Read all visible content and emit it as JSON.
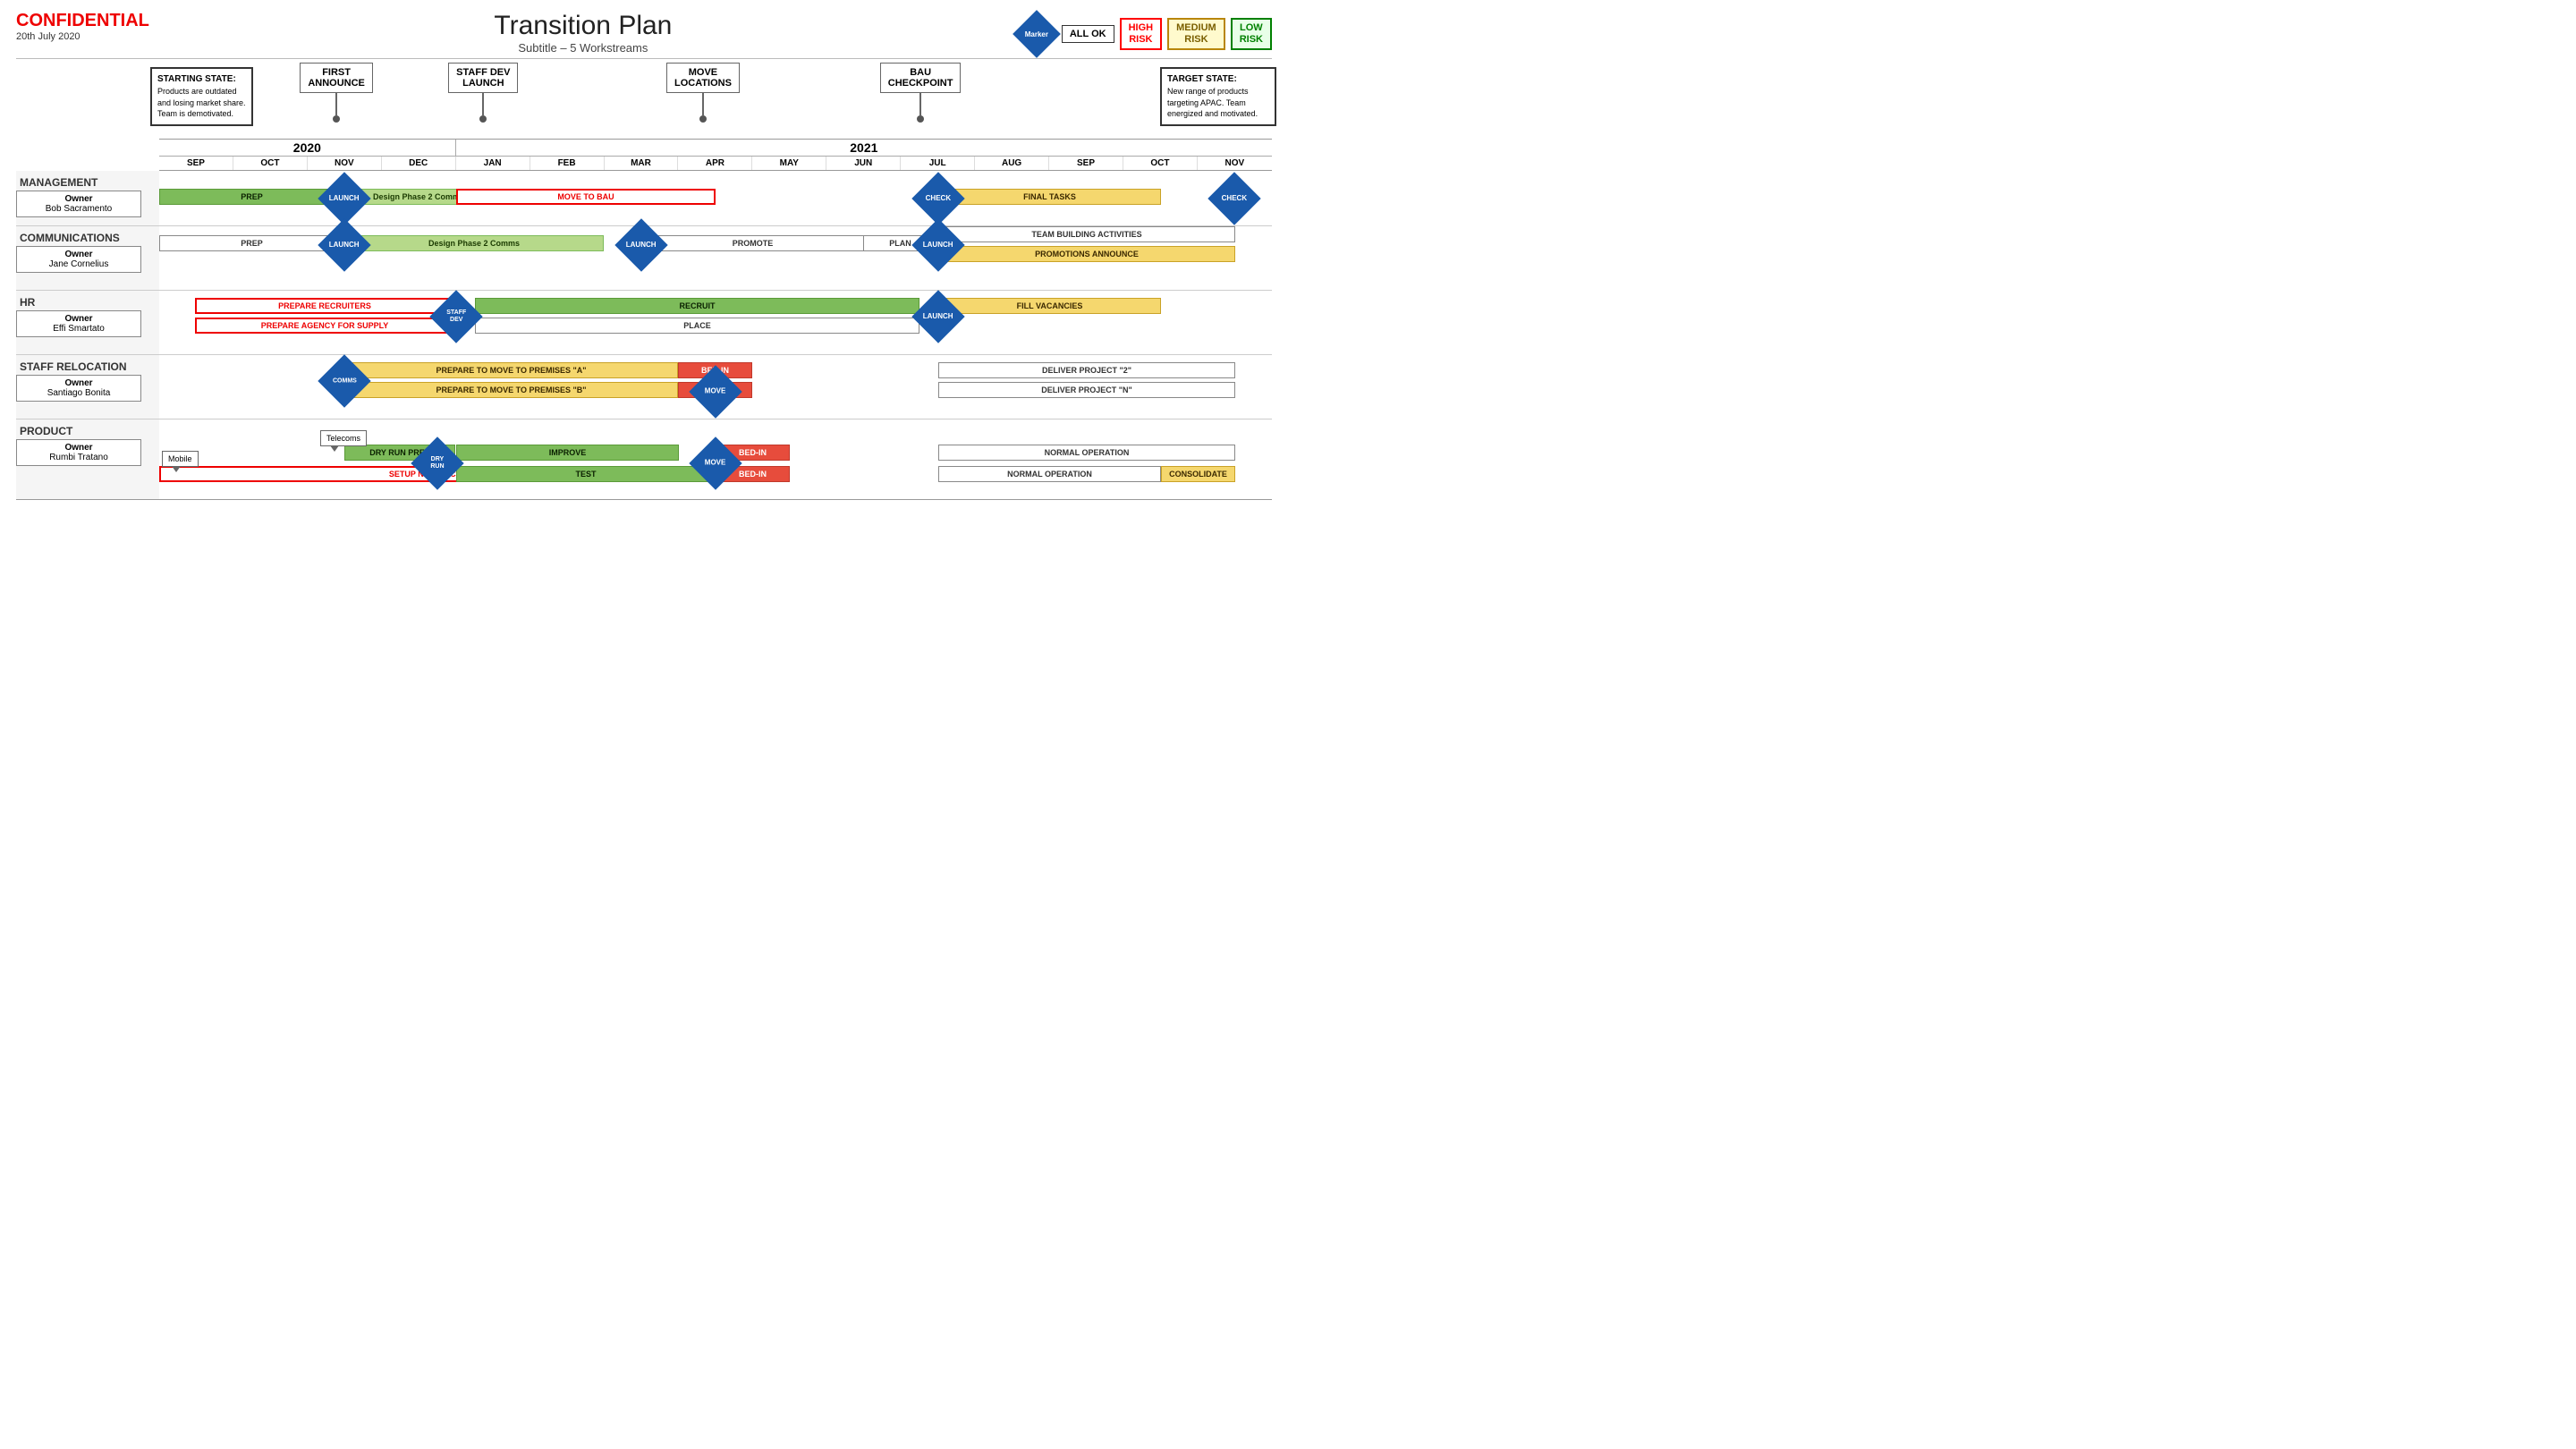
{
  "header": {
    "confidential": "CONFIDENTIAL",
    "date": "20th July 2020",
    "title": "Transition Plan",
    "subtitle": "Subtitle – 5 Workstreams",
    "legend_marker": "Marker",
    "legend_all_ok": "ALL OK",
    "legend_high": "HIGH\nRISK",
    "legend_medium": "MEDIUM\nRISK",
    "legend_low": "LOW\nRISK"
  },
  "milestones": [
    {
      "label": "FIRST ANNOUNCE",
      "col": 2
    },
    {
      "label": "STAFF DEV LAUNCH",
      "col": 4
    },
    {
      "label": "MOVE LOCATIONS",
      "col": 7
    },
    {
      "label": "BAU CHECKPOINT",
      "col": 10
    }
  ],
  "starting_state": "Products are outdated and losing market share. Team is demotivated.",
  "target_state": "New range of products targeting APAC. Team energized and motivated.",
  "months": [
    "SEP",
    "OCT",
    "NOV",
    "DEC",
    "JAN",
    "FEB",
    "MAR",
    "APR",
    "MAY",
    "JUN",
    "JUL",
    "AUG",
    "SEP",
    "OCT",
    "NOV"
  ],
  "years": [
    {
      "label": "2020",
      "cols": 4
    },
    {
      "label": "2021",
      "cols": 11
    }
  ],
  "workstreams": [
    {
      "id": "management",
      "title": "MANAGEMENT",
      "owner_label": "Owner",
      "owner_name": "Bob Sacramento"
    },
    {
      "id": "communications",
      "title": "COMMUNICATIONS",
      "owner_label": "Owner",
      "owner_name": "Jane Cornelius"
    },
    {
      "id": "hr",
      "title": "HR",
      "owner_label": "Owner",
      "owner_name": "Effi Smartato"
    },
    {
      "id": "staff_relocation",
      "title": "STAFF RELOCATION",
      "owner_label": "Owner",
      "owner_name": "Santiago Bonita"
    },
    {
      "id": "product",
      "title": "PRODUCT",
      "owner_label": "Owner",
      "owner_name": "Rumbi Tratano"
    }
  ]
}
